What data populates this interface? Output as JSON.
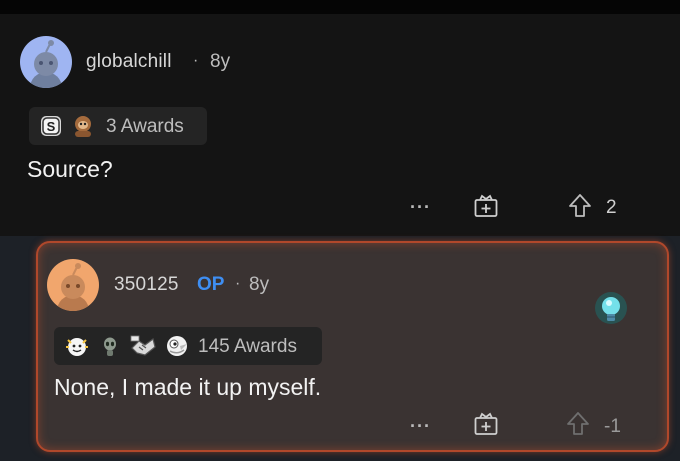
{
  "parent_comment": {
    "username": "globalchill",
    "separator": "·",
    "age": "8y",
    "awards": {
      "icons": [
        "silver-s-icon",
        "sloth-award-icon"
      ],
      "count_label": "3 Awards"
    },
    "text": "Source?",
    "actions": {
      "more_label": "···",
      "gift_icon": "gift-icon",
      "upvote_icon": "upvote-arrow-icon",
      "vote_count": "2"
    }
  },
  "reply_comment": {
    "username": "350125",
    "op_label": "OP",
    "separator": "·",
    "age": "8y",
    "flair_icon": "lightbulb-icon",
    "awards": {
      "icons": [
        "wholesome-seal-icon",
        "alien-ghost-icon",
        "handshake-award-icon",
        "bird-award-icon"
      ],
      "count_label": "145 Awards"
    },
    "text": "None, I made it up myself.",
    "actions": {
      "more_label": "···",
      "gift_icon": "gift-icon",
      "upvote_icon": "upvote-arrow-icon",
      "vote_count": "-1"
    }
  },
  "colors": {
    "background": "#000000",
    "parent_bg": "#141414",
    "reply_card_bg": "#3a3332",
    "reply_border": "#b0482b",
    "op_blue": "#3e8ef2"
  }
}
